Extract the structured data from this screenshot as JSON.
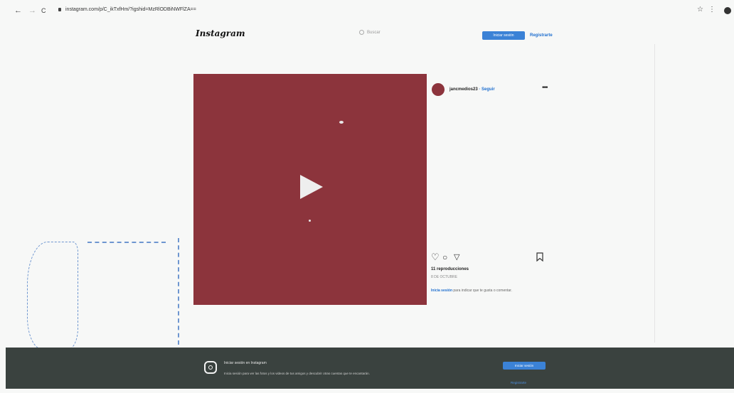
{
  "browser": {
    "back": "←",
    "forward": "→",
    "reload": "C",
    "url": "instagram.com/p/C_ikTxfHm/?igshid=MzRlODBiNWFlZA=="
  },
  "header": {
    "logo": "Instagram",
    "search_placeholder": "Buscar",
    "login_label": "Iniciar sesión",
    "register_label": "Registrarte"
  },
  "post": {
    "username": "jancmedios23",
    "follow_label": "· Seguir",
    "more": "•••",
    "plays": "11 reproducciones",
    "date": "8 DE OCTUBRE",
    "login_link": "Inicia sesión",
    "login_text": " para indicar que te gusta o comentar."
  },
  "icons": {
    "like": "heart-icon",
    "comment": "comment-icon",
    "share": "send-icon",
    "save": "bookmark-icon"
  },
  "banner": {
    "title": "Iniciar sesión en Instagram",
    "description": "Inicia sesión para ver las fotos y los videos de tus amigos y descubrir otras cuentas que te encantarán.",
    "login_label": "Iniciar sesión",
    "register_label": "Registrarte"
  },
  "colors": {
    "media": "#8c343c",
    "accent": "#3b82d6",
    "banner": "#3a423f"
  }
}
